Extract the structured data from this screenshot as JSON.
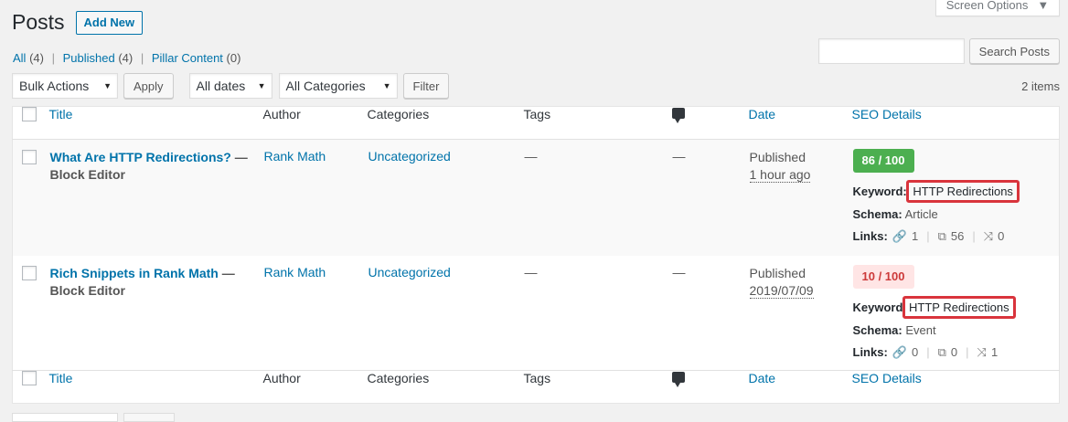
{
  "header": {
    "title": "Posts",
    "add_new": "Add New",
    "screen_options": "Screen Options"
  },
  "views": [
    {
      "label": "All",
      "count": "(4)"
    },
    {
      "label": "Published",
      "count": "(4)"
    },
    {
      "label": "Pillar Content",
      "count": "(0)"
    }
  ],
  "search": {
    "button": "Search Posts",
    "value": ""
  },
  "filters": {
    "bulk_actions": "Bulk Actions",
    "apply": "Apply",
    "dates": "All dates",
    "categories": "All Categories",
    "filter": "Filter"
  },
  "items_count": "2 items",
  "columns": {
    "title": "Title",
    "author": "Author",
    "categories": "Categories",
    "tags": "Tags",
    "date": "Date",
    "seo": "SEO Details"
  },
  "rows": [
    {
      "title": "What Are HTTP Redirections?",
      "state": "— Block Editor",
      "author": "Rank Math",
      "category": "Uncategorized",
      "tags": "—",
      "comments": "—",
      "status": "Published",
      "date": "1 hour ago",
      "score": "86 / 100",
      "keyword_label": "Keyword:",
      "keyword": "HTTP Redirections",
      "schema_label": "Schema:",
      "schema": "Article",
      "links_label": "Links:",
      "internal_links": "1",
      "external_links": "56",
      "incoming_links": "0"
    },
    {
      "title": "Rich Snippets in Rank Math",
      "state": "— Block Editor",
      "author": "Rank Math",
      "category": "Uncategorized",
      "tags": "—",
      "comments": "—",
      "status": "Published",
      "date": "2019/07/09",
      "score": "10 / 100",
      "keyword_label": "Keyword",
      "keyword": "HTTP Redirections",
      "schema_label": "Schema:",
      "schema": "Event",
      "links_label": "Links:",
      "internal_links": "0",
      "external_links": "0",
      "incoming_links": "1"
    }
  ],
  "colors": {
    "link": "#0073aa",
    "score_good": "#4caf50",
    "score_bad_bg": "#ffe5e5",
    "highlight": "#d9343c"
  }
}
